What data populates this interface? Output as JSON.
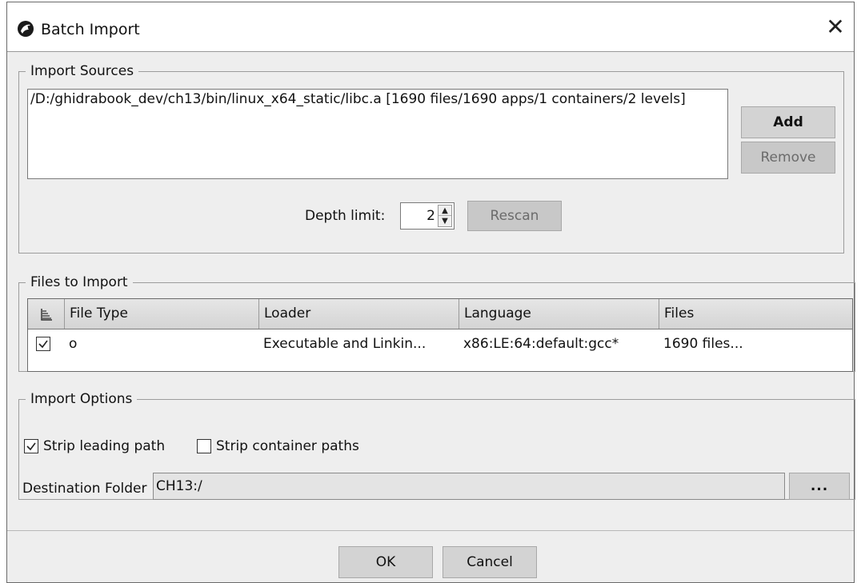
{
  "window": {
    "title": "Batch Import",
    "icon": "ghidra-dragon-icon",
    "close_glyph": "✕"
  },
  "import_sources": {
    "legend": "Import Sources",
    "entries": [
      "/D:/ghidrabook_dev/ch13/bin/linux_x64_static/libc.a [1690 files/1690 apps/1 containers/2 levels]"
    ],
    "add_label": "Add",
    "remove_label": "Remove",
    "depth_label": "Depth limit:",
    "depth_value": "2",
    "rescan_label": "Rescan"
  },
  "files_to_import": {
    "legend": "Files to Import",
    "columns": [
      "File Type",
      "Loader",
      "Language",
      "Files"
    ],
    "rows": [
      {
        "checked": true,
        "file_type": "o",
        "loader": "Executable and Linkin...",
        "language": "x86:LE:64:default:gcc*",
        "files": "1690 files..."
      }
    ]
  },
  "import_options": {
    "legend": "Import Options",
    "strip_leading_label": "Strip leading path",
    "strip_leading_checked": true,
    "strip_container_label": "Strip container paths",
    "strip_container_checked": false,
    "destination_label": "Destination Folder",
    "destination_value": "CH13:/",
    "browse_label": "..."
  },
  "footer": {
    "ok_label": "OK",
    "cancel_label": "Cancel"
  }
}
